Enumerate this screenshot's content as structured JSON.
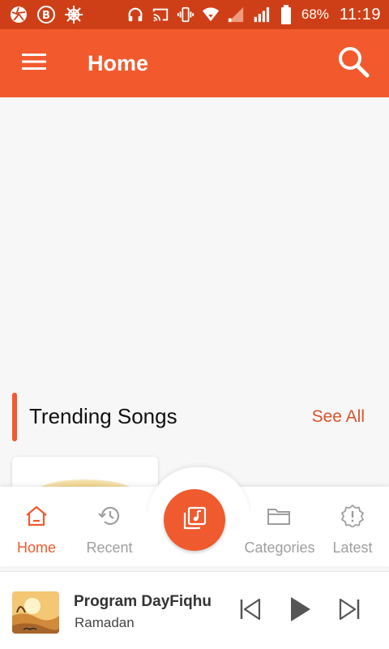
{
  "status_bar": {
    "battery_percent": "68%",
    "time": "11:19"
  },
  "app_bar": {
    "title": "Home"
  },
  "section": {
    "title": "Trending Songs",
    "see_all_label": "See All"
  },
  "bottom_nav": {
    "items": [
      {
        "label": "Home",
        "icon": "home-icon",
        "active": true
      },
      {
        "label": "Recent",
        "icon": "history-icon",
        "active": false
      },
      {
        "label": "Categories",
        "icon": "folder-icon",
        "active": false
      },
      {
        "label": "Latest",
        "icon": "alert-badge-icon",
        "active": false
      }
    ],
    "center_button_icon": "music-library-icon"
  },
  "player": {
    "title": "Program DayFiqhu",
    "subtitle": "Ramadan"
  },
  "colors": {
    "accent": "#f25a2e",
    "status_bar": "#cf3f17",
    "inactive": "#9e9e9e"
  }
}
